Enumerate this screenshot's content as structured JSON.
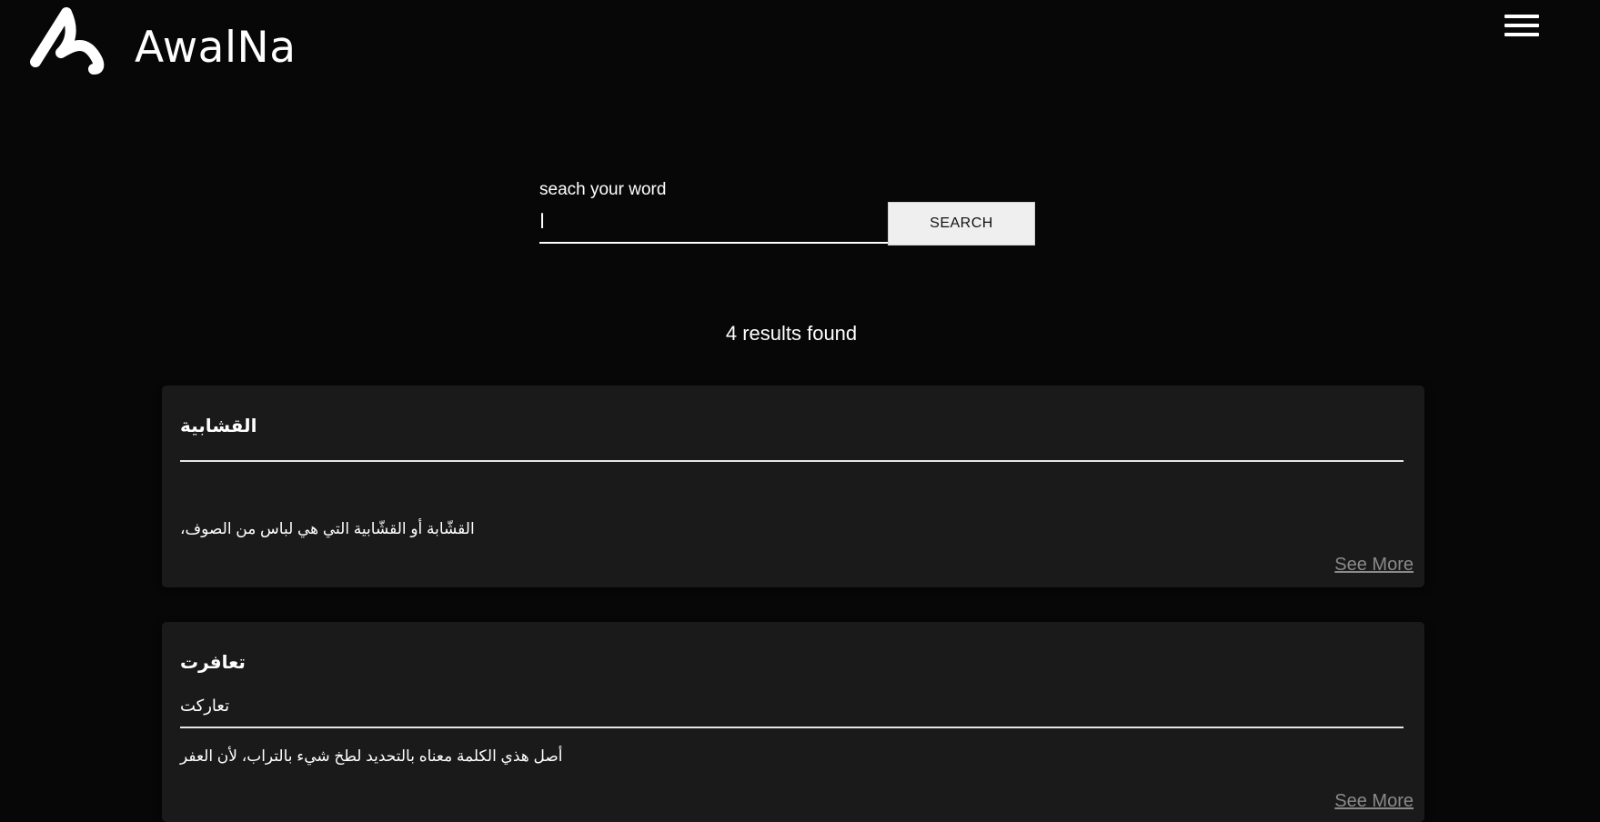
{
  "header": {
    "brand_name": "AwalNa",
    "logo_icon": "awalna-logo-icon",
    "menu_icon": "hamburger-menu-icon"
  },
  "search": {
    "label": "seach your word",
    "value": "ا",
    "button_label": "SEARCH"
  },
  "results": {
    "count_text": "4 results found",
    "items": [
      {
        "title": "القشابية",
        "subtitle": "",
        "description": "القشّابة أو القشّابية التي هي لباس من الصوف،",
        "see_more_label": "See More"
      },
      {
        "title": "تعافرت",
        "subtitle": "تعاركت",
        "description": "أصل هذي الكلمة معناه بالتحديد لطخ شيء بالتراب، لأن العفر",
        "see_more_label": "See More"
      }
    ]
  },
  "colors": {
    "background": "#070707",
    "card_background": "#1a1a1a",
    "text": "#ffffff",
    "link_muted": "#8a8a8a",
    "button_background": "#efefef"
  }
}
